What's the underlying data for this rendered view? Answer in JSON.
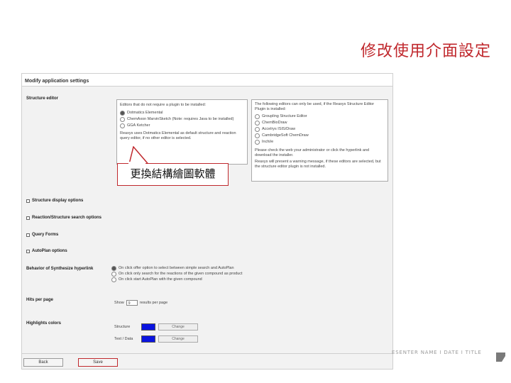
{
  "slide": {
    "title": "修改使用介面設定",
    "callout": "更換結構繪圖軟體",
    "footer": "ESENTER NAME I DATE I TITLE"
  },
  "screenshot": {
    "header": "Modify application settings",
    "structure_editor_label": "Structure editor",
    "left_box": {
      "heading": "Editors that do not require a plugin to be installed:",
      "options": [
        {
          "label": "Dotmatics Elemental",
          "selected": true
        },
        {
          "label": "ChemAxon MarvinSketch (Note: requires Java to be installed)",
          "selected": false
        },
        {
          "label": "GGA Ketcher",
          "selected": false
        }
      ],
      "note": "Reaxys uses Dotmatics Elemental as default structure and reaction query editor, if no other editor is selected."
    },
    "right_box": {
      "heading": "The following editors can only be used, if the Reaxys Structure Editor Plugin is installed:",
      "options": [
        {
          "label": "Groupling Structure Editor",
          "selected": false
        },
        {
          "label": "ChemBioDraw",
          "selected": false
        },
        {
          "label": "Accelrys ISIS/Draw",
          "selected": false
        },
        {
          "label": "CambridgeSoft ChemDraw",
          "selected": false
        },
        {
          "label": "Inchi/e",
          "selected": false
        }
      ],
      "note1": "Please check the web your administrator or click the hyperlink and download the installer.",
      "note2": "Reaxys will present a warning message, if these editors are selected, but the structure editor plugin is not installed."
    },
    "sections": [
      "Structure display options",
      "Reaction/Structure search options",
      "Query Forms",
      "AutoPlan options"
    ],
    "synthesize": {
      "label": "Behavior of Synthesize hyperlink",
      "options": [
        {
          "label": "On click offer option to select between simple search and AutoPlan",
          "selected": true
        },
        {
          "label": "On click only search for the reactions of the given compound as product",
          "selected": false
        },
        {
          "label": "On click start AutoPlan with the given compound",
          "selected": false
        }
      ]
    },
    "hits": {
      "label": "Hits per page",
      "show": "Show",
      "value": "9",
      "suffix": "results per page"
    },
    "highlight": {
      "label": "Highlights colors",
      "rows": [
        {
          "name": "Structure",
          "button": "Change",
          "color": "#0a14e0"
        },
        {
          "name": "Text / Data",
          "button": "Change",
          "color": "#0a14e0"
        }
      ]
    },
    "buttons": {
      "back": "Back",
      "save": "Save"
    }
  },
  "colors": {
    "accent": "#c0282d",
    "swatch": "#0a14e0"
  }
}
